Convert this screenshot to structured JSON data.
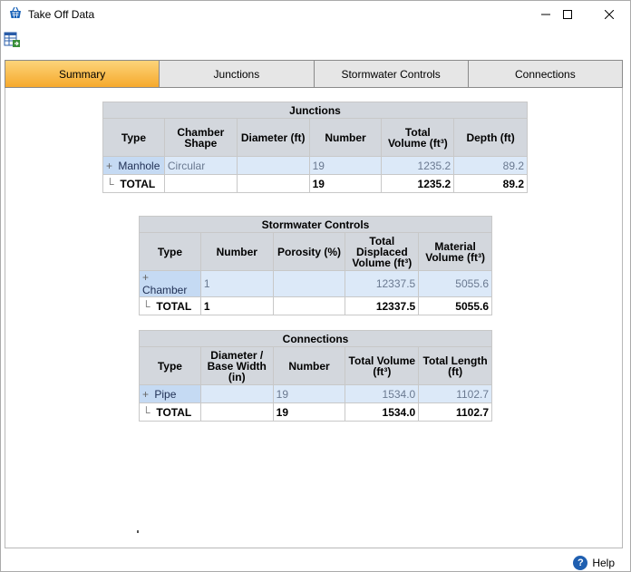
{
  "window": {
    "title": "Take Off Data",
    "icon": "basket-icon",
    "controls": {
      "minimize": "minimize-icon",
      "maximize": "maximize-icon",
      "close": "close-icon"
    }
  },
  "toolbar": {
    "export_icon": "export-table-icon"
  },
  "tabs": [
    {
      "label": "Summary",
      "active": true
    },
    {
      "label": "Junctions",
      "active": false
    },
    {
      "label": "Stormwater Controls",
      "active": false
    },
    {
      "label": "Connections",
      "active": false
    }
  ],
  "junctions": {
    "title": "Junctions",
    "columns": [
      "Type",
      "Chamber Shape",
      "Diameter (ft)",
      "Number",
      "Total Volume (ft³)",
      "Depth (ft)"
    ],
    "row": {
      "type": "Manhole",
      "shape": "Circular",
      "diameter": "",
      "number": "19",
      "volume": "1235.2",
      "depth": "89.2"
    },
    "total": {
      "label": "TOTAL",
      "number": "19",
      "volume": "1235.2",
      "depth": "89.2"
    }
  },
  "stormwater": {
    "title": "Stormwater Controls",
    "columns": [
      "Type",
      "Number",
      "Porosity (%)",
      "Total Displaced Volume (ft³)",
      "Material Volume (ft³)"
    ],
    "row": {
      "type": "Chamber",
      "number": "1",
      "porosity": "",
      "displaced": "12337.5",
      "material": "5055.6"
    },
    "total": {
      "label": "TOTAL",
      "number": "1",
      "displaced": "12337.5",
      "material": "5055.6"
    }
  },
  "connections": {
    "title": "Connections",
    "columns": [
      "Type",
      "Diameter / Base Width (in)",
      "Number",
      "Total Volume (ft³)",
      "Total Length (ft)"
    ],
    "row": {
      "type": "Pipe",
      "diameter": "",
      "number": "19",
      "volume": "1534.0",
      "length": "1102.7"
    },
    "total": {
      "label": "TOTAL",
      "number": "19",
      "volume": "1534.0",
      "length": "1102.7"
    }
  },
  "footer": {
    "help_label": "Help"
  },
  "colors": {
    "active_tab": "#f6a92c",
    "header_bg": "#d3d7dd",
    "row_bg": "#dce9f8",
    "help_icon": "#1f5fb0"
  }
}
